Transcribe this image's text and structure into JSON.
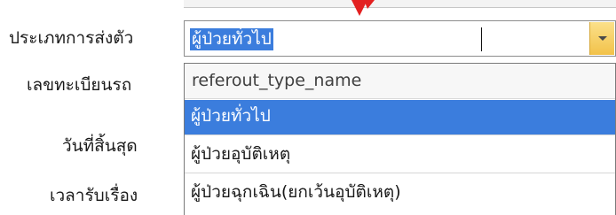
{
  "form": {
    "referral_type_label": "ประเภทการส่งตัว",
    "license_plate_label": "เลขทะเบียนรถ",
    "end_date_label": "วันที่สิ้นสุด",
    "receive_time_label": "เวลารับเรื่อง"
  },
  "combo": {
    "selected_value": "ผู้ป่วยทั่วไป",
    "selection_color": "#3b7ddd",
    "dropdown_button_color": "#f2c24a"
  },
  "dropdown": {
    "header": "referout_type_name",
    "items": [
      {
        "label": "ผู้ป่วยทั่วไป",
        "selected": true
      },
      {
        "label": "ผู้ป่วยอุบัติเหตุ",
        "selected": false
      },
      {
        "label": "ผู้ป่วยฉุกเฉิน(ยกเว้นอุบัติเหตุ)",
        "selected": false
      }
    ]
  },
  "annotation": {
    "arrow_color": "#e32020",
    "arrow_icon": "red-pointer-arrow-icon"
  }
}
